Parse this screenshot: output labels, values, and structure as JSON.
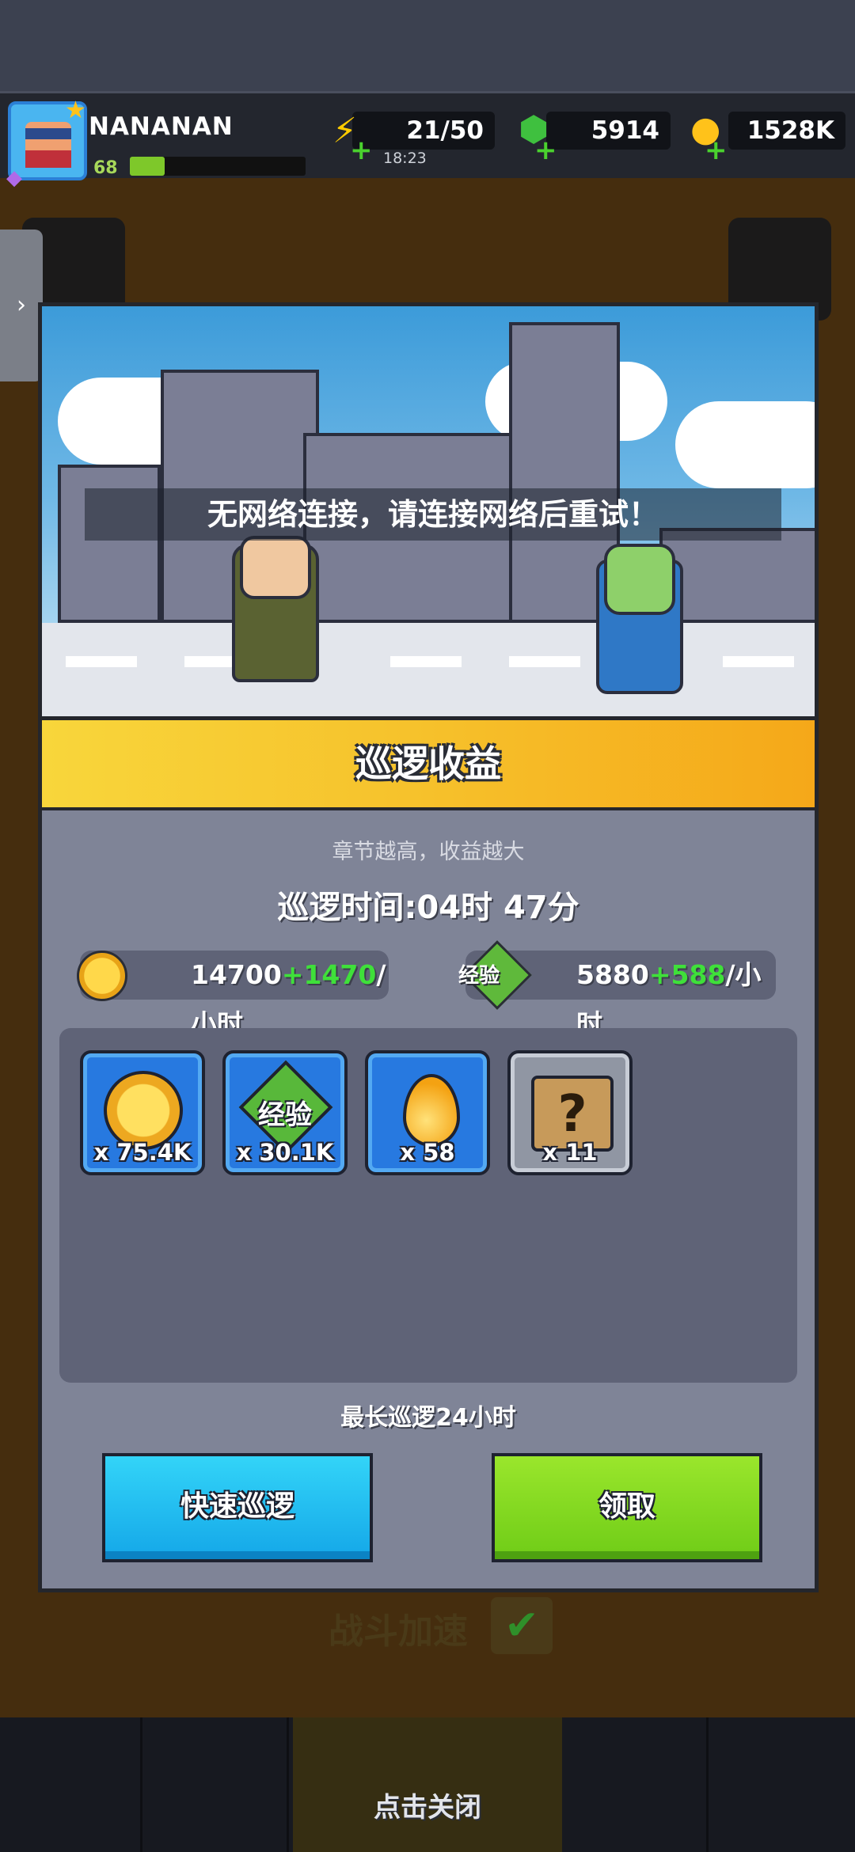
{
  "player": {
    "name": "NANANAN",
    "level": "68",
    "xp_fraction": 0.2
  },
  "resources": {
    "energy": "21/50",
    "energy_timer": "18:23",
    "gems": "5914",
    "coins": "1528K"
  },
  "scene": {
    "message": "无网络连接，请连接网络后重试！"
  },
  "modal": {
    "title": "巡逻收益",
    "hint": "章节越高，收益越大",
    "patrol_time": "巡逻时间:04时 47分",
    "coin_rate": {
      "base": "14700",
      "bonus": "+1470",
      "unit": "/小时"
    },
    "exp_rate": {
      "icon_label": "经验",
      "base": "5880",
      "bonus": "+588",
      "unit": "/小时"
    },
    "rewards": [
      {
        "icon": "coin-icon",
        "qty": "x 75.4K"
      },
      {
        "icon": "exp-icon",
        "label": "经验",
        "qty": "x 30.1K"
      },
      {
        "icon": "drop-icon",
        "qty": "x 58"
      },
      {
        "icon": "mystery-map-icon",
        "qty": "x 11"
      }
    ],
    "max_patrol": "最长巡逻24小时",
    "fast_patrol_label": "快速巡逻",
    "claim_label": "领取"
  },
  "background": {
    "speed_label": "战斗加速"
  },
  "close_tip": "点击关闭"
}
